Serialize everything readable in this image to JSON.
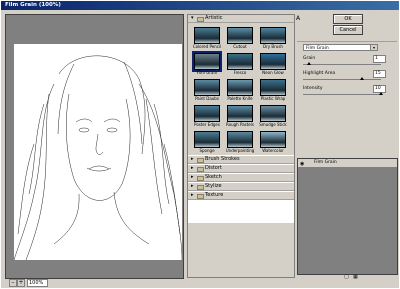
{
  "window": {
    "title": "Film Grain (100%)"
  },
  "preview": {
    "zoom_value": "100%",
    "minus": "–",
    "plus": "+"
  },
  "gallery": {
    "artistic": {
      "label": "Artistic",
      "arrow": "▾"
    },
    "thumbnails": [
      {
        "label": "Colored Pencil",
        "color": "#4a7c93"
      },
      {
        "label": "Cutout",
        "color": "#5b8fa8"
      },
      {
        "label": "Dry Brush",
        "color": "#4f86a3"
      },
      {
        "label": "Film Grain",
        "color": "#6e7f88"
      },
      {
        "label": "Fresco",
        "color": "#3d6f89"
      },
      {
        "label": "Neon Glow",
        "color": "#2d6f9c"
      },
      {
        "label": "Paint Daubs",
        "color": "#5a8aa3"
      },
      {
        "label": "Palette Knife",
        "color": "#6a98ae"
      },
      {
        "label": "Plastic Wrap",
        "color": "#3b6f8c"
      },
      {
        "label": "Poster Edges",
        "color": "#4d7f99"
      },
      {
        "label": "Rough Pastels",
        "color": "#5e8ea6"
      },
      {
        "label": "Smudge Stick",
        "color": "#6a8ea1"
      },
      {
        "label": "Sponge",
        "color": "#4e7d95"
      },
      {
        "label": "Underpainting",
        "color": "#5c8aa0"
      },
      {
        "label": "Watercolor",
        "color": "#8fb7cc"
      }
    ],
    "categories": [
      {
        "label": "Brush Strokes",
        "arrow": "▸"
      },
      {
        "label": "Distort",
        "arrow": "▸"
      },
      {
        "label": "Sketch",
        "arrow": "▸"
      },
      {
        "label": "Stylize",
        "arrow": "▸"
      },
      {
        "label": "Texture",
        "arrow": "▸"
      }
    ]
  },
  "right": {
    "collapse_glyph": "A",
    "ok_label": "OK",
    "cancel_label": "Cancel",
    "filter_select": "Film Grain",
    "dropdown_glyph": "▾",
    "params": [
      {
        "label": "Grain",
        "value": "1",
        "level": 0.05
      },
      {
        "label": "Highlight Area",
        "value": "15",
        "level": 0.75
      },
      {
        "label": "Intensity",
        "value": "10",
        "level": 1.0
      }
    ]
  },
  "layers": {
    "items": [
      {
        "label": "Film Grain",
        "eye": "◉"
      }
    ],
    "new_layer_glyph": "▢",
    "delete_glyph": "▦"
  },
  "colors": {
    "titlebar": "#0a246a",
    "dialog": "#d4d0c8"
  }
}
